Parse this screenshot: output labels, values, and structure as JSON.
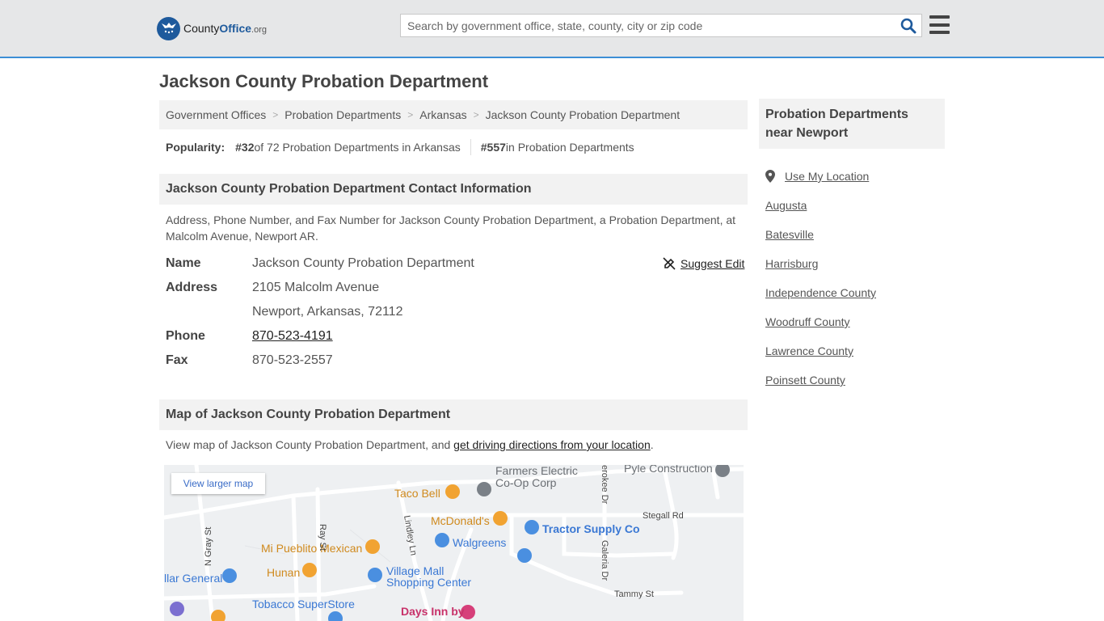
{
  "header": {
    "logo_text_a": "County",
    "logo_text_b": "Office",
    "logo_text_c": ".org",
    "search_placeholder": "Search by government office, state, county, city or zip code"
  },
  "page": {
    "title": "Jackson County Probation Department"
  },
  "breadcrumb": [
    "Government Offices",
    "Probation Departments",
    "Arkansas",
    "Jackson County Probation Department"
  ],
  "popularity": {
    "label": "Popularity:",
    "rank_state": "#32",
    "rank_state_text": " of 72 Probation Departments in Arkansas",
    "rank_all": "#557",
    "rank_all_text": " in Probation Departments"
  },
  "contact": {
    "heading": "Jackson County Probation Department Contact Information",
    "description": "Address, Phone Number, and Fax Number for Jackson County Probation Department, a Probation Department, at Malcolm Avenue, Newport AR.",
    "suggest_edit": "Suggest Edit",
    "rows": {
      "name_label": "Name",
      "name_value": "Jackson County Probation Department",
      "address_label": "Address",
      "address_line1": "2105 Malcolm Avenue",
      "address_line2": "Newport, Arkansas, 72112",
      "phone_label": "Phone",
      "phone_value": "870-523-4191",
      "fax_label": "Fax",
      "fax_value": "870-523-2557"
    }
  },
  "map_section": {
    "heading": "Map of Jackson County Probation Department",
    "desc_prefix": "View map of Jackson County Probation Department, and ",
    "desc_link": "get driving directions from your location",
    "desc_suffix": ".",
    "view_larger": "View larger map",
    "labels": {
      "farmers": "Farmers Electric",
      "farmers2": "Co-Op Corp",
      "pyle": "Pyle Construction",
      "taco": "Taco Bell",
      "mcdonalds": "McDonald's",
      "tractor": "Tractor Supply Co",
      "walgreens": "Walgreens",
      "stegall": "Stegall Rd",
      "pueblito": "Mi Pueblito Mexican",
      "hunan": "Hunan",
      "village": "Village Mall",
      "village2": "Shopping Center",
      "general": "llar General",
      "tobacco": "Tobacco SuperStore",
      "daysinn": "Days Inn by",
      "tammy": "Tammy St",
      "ngray": "N Gray St",
      "ray": "Ray St",
      "lindley": "Lindley Ln",
      "galeria": "Galeria Dr",
      "cherokee": "erokee Dr"
    }
  },
  "sidebar": {
    "heading": "Probation Departments near Newport",
    "use_location": "Use My Location",
    "links": [
      "Augusta",
      "Batesville",
      "Harrisburg",
      "Independence County",
      "Woodruff County",
      "Lawrence County",
      "Poinsett County"
    ]
  }
}
